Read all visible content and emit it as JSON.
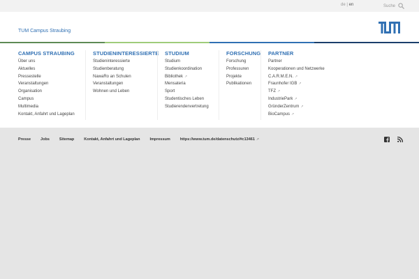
{
  "topbar": {
    "lang_de": "de",
    "lang_sep": "|",
    "lang_en": "en",
    "search_label": "Suche"
  },
  "header": {
    "site_title": "TUM Campus Straubing",
    "logo_text": "TUM"
  },
  "stripe_colors": [
    "#5e8a55",
    "#9fcc7a",
    "#3070b3",
    "#1b3f6b"
  ],
  "menu": [
    {
      "title": "CAMPUS STRAUBING",
      "items": [
        {
          "label": "Über uns"
        },
        {
          "label": "Aktuelles"
        },
        {
          "label": "Pressestelle"
        },
        {
          "label": "Veranstaltungen"
        },
        {
          "label": "Organisation"
        },
        {
          "label": "Campus"
        },
        {
          "label": "Multimedia"
        },
        {
          "label": "Kontakt, Anfahrt und Lageplan"
        }
      ]
    },
    {
      "title": "STUDIENINTERESSIERTE",
      "items": [
        {
          "label": "Studieninteressierte"
        },
        {
          "label": "Studienberatung"
        },
        {
          "label": "NawaRo an Schulen"
        },
        {
          "label": "Veranstaltungen"
        },
        {
          "label": "Wohnen und Leben"
        }
      ]
    },
    {
      "title": "STUDIUM",
      "items": [
        {
          "label": "Studium"
        },
        {
          "label": "Studienkoordination"
        },
        {
          "label": "Bibliothek",
          "ext": true
        },
        {
          "label": "Mensateria"
        },
        {
          "label": "Sport"
        },
        {
          "label": "Studentisches Leben"
        },
        {
          "label": "Studierendenvertretung"
        }
      ]
    },
    {
      "title": "FORSCHUNG",
      "items": [
        {
          "label": "Forschung"
        },
        {
          "label": "Professuren"
        },
        {
          "label": "Projekte"
        },
        {
          "label": "Publikationen"
        }
      ]
    },
    {
      "title": "PARTNER",
      "items": [
        {
          "label": "Partner"
        },
        {
          "label": "Kooperationen und Netzwerke"
        },
        {
          "label": "C.A.R.M.E.N.",
          "ext": true
        },
        {
          "label": "Fraunhofer IGB",
          "ext": true
        },
        {
          "label": "TFZ",
          "ext": true
        },
        {
          "label": "IndustriePark",
          "ext": true
        },
        {
          "label": "GründerZentrum",
          "ext": true
        },
        {
          "label": "BioCampus",
          "ext": true
        }
      ]
    }
  ],
  "footer": {
    "links": [
      "Presse",
      "Jobs",
      "Sitemap",
      "Kontakt, Anfahrt und Lageplan",
      "Impressum",
      "https://www.tum.de/datenschutz/#c13461"
    ]
  }
}
